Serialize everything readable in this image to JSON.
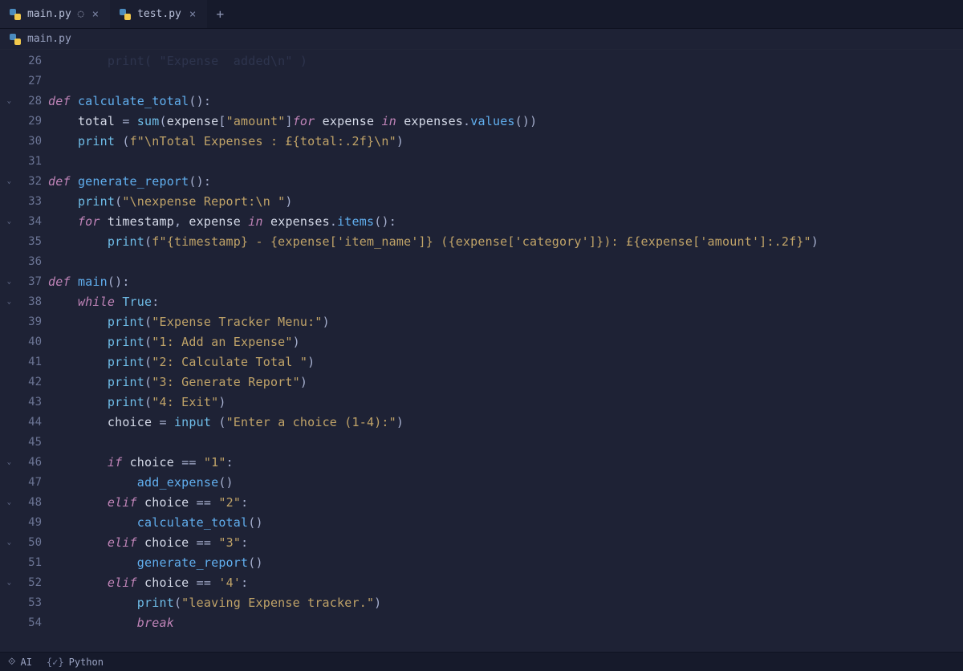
{
  "tabs": [
    {
      "label": "main.py",
      "active": true,
      "dirty": true
    },
    {
      "label": "test.py",
      "active": false,
      "dirty": false
    }
  ],
  "breadcrumb": {
    "file": "main.py"
  },
  "gutter_start": 26,
  "lines": [
    {
      "n": 26,
      "fold": false,
      "html": "<span class='cutoff'>        print( \"Expense  added\\n\" )</span>"
    },
    {
      "n": 27,
      "fold": false,
      "html": ""
    },
    {
      "n": 28,
      "fold": true,
      "html": "<span class='kw'>def</span> <span class='fn'>calculate_total</span><span class='op'>():</span>"
    },
    {
      "n": 29,
      "fold": false,
      "html": "    <span class='var'>total</span> <span class='op'>=</span> <span class='bi'>sum</span><span class='op'>(</span><span class='var'>expense</span><span class='op'>[</span><span class='str'>\"amount\"</span><span class='op'>]</span><span class='kw'>for</span> <span class='var'>expense</span> <span class='kw'>in</span> <span class='var'>expenses</span><span class='op'>.</span><span class='fn'>values</span><span class='op'>())</span>"
    },
    {
      "n": 30,
      "fold": false,
      "html": "    <span class='bi'>print</span> <span class='op'>(</span><span class='str'>f\"\\nTotal Expenses : £{total:.2f}\\n\"</span><span class='op'>)</span>"
    },
    {
      "n": 31,
      "fold": false,
      "html": ""
    },
    {
      "n": 32,
      "fold": true,
      "html": "<span class='kw'>def</span> <span class='fn'>generate_report</span><span class='op'>():</span>"
    },
    {
      "n": 33,
      "fold": false,
      "html": "    <span class='bi'>print</span><span class='op'>(</span><span class='str'>\"\\nexpense Report:\\n \"</span><span class='op'>)</span>"
    },
    {
      "n": 34,
      "fold": true,
      "html": "    <span class='kw'>for</span> <span class='var'>timestamp</span><span class='op'>,</span> <span class='var'>expense</span> <span class='kw'>in</span> <span class='var'>expenses</span><span class='op'>.</span><span class='fn'>items</span><span class='op'>():</span>"
    },
    {
      "n": 35,
      "fold": false,
      "html": "        <span class='bi'>print</span><span class='op'>(</span><span class='str'>f\"{timestamp} - {expense['item_name']} ({expense['category']}): £{expense['amount']:.2f}\"</span><span class='op'>)</span>"
    },
    {
      "n": 36,
      "fold": false,
      "html": ""
    },
    {
      "n": 37,
      "fold": true,
      "html": "<span class='kw'>def</span> <span class='fn'>main</span><span class='op'>():</span>"
    },
    {
      "n": 38,
      "fold": true,
      "html": "    <span class='kw'>while</span> <span class='bi'>True</span><span class='op'>:</span>"
    },
    {
      "n": 39,
      "fold": false,
      "html": "        <span class='bi'>print</span><span class='op'>(</span><span class='str'>\"Expense Tracker Menu:\"</span><span class='op'>)</span>"
    },
    {
      "n": 40,
      "fold": false,
      "html": "        <span class='bi'>print</span><span class='op'>(</span><span class='str'>\"1: Add an Expense\"</span><span class='op'>)</span>"
    },
    {
      "n": 41,
      "fold": false,
      "html": "        <span class='bi'>print</span><span class='op'>(</span><span class='str'>\"2: Calculate Total \"</span><span class='op'>)</span>"
    },
    {
      "n": 42,
      "fold": false,
      "html": "        <span class='bi'>print</span><span class='op'>(</span><span class='str'>\"3: Generate Report\"</span><span class='op'>)</span>"
    },
    {
      "n": 43,
      "fold": false,
      "html": "        <span class='bi'>print</span><span class='op'>(</span><span class='str'>\"4: Exit\"</span><span class='op'>)</span>"
    },
    {
      "n": 44,
      "fold": false,
      "html": "        <span class='var'>choice</span> <span class='op'>=</span> <span class='bi'>input</span> <span class='op'>(</span><span class='str'>\"Enter a choice (1-4):\"</span><span class='op'>)</span>"
    },
    {
      "n": 45,
      "fold": false,
      "html": ""
    },
    {
      "n": 46,
      "fold": true,
      "html": "        <span class='kw'>if</span> <span class='var'>choice</span> <span class='op'>==</span> <span class='str'>\"1\"</span><span class='op'>:</span>"
    },
    {
      "n": 47,
      "fold": false,
      "html": "            <span class='fn'>add_expense</span><span class='op'>()</span>"
    },
    {
      "n": 48,
      "fold": true,
      "html": "        <span class='kw'>elif</span> <span class='var'>choice</span> <span class='op'>==</span> <span class='str'>\"2\"</span><span class='op'>:</span>"
    },
    {
      "n": 49,
      "fold": false,
      "html": "            <span class='fn'>calculate_total</span><span class='op'>()</span>"
    },
    {
      "n": 50,
      "fold": true,
      "html": "        <span class='kw'>elif</span> <span class='var'>choice</span> <span class='op'>==</span> <span class='str'>\"3\"</span><span class='op'>:</span>"
    },
    {
      "n": 51,
      "fold": false,
      "html": "            <span class='fn'>generate_report</span><span class='op'>()</span>"
    },
    {
      "n": 52,
      "fold": true,
      "html": "        <span class='kw'>elif</span> <span class='var'>choice</span> <span class='op'>==</span> <span class='str'>'4'</span><span class='op'>:</span>"
    },
    {
      "n": 53,
      "fold": false,
      "html": "            <span class='bi'>print</span><span class='op'>(</span><span class='str'>\"leaving Expense tracker.\"</span><span class='op'>)</span>"
    },
    {
      "n": 54,
      "fold": false,
      "html": "            <span class='kw'>break</span>"
    }
  ],
  "status": {
    "ai": "AI",
    "language": "Python"
  }
}
